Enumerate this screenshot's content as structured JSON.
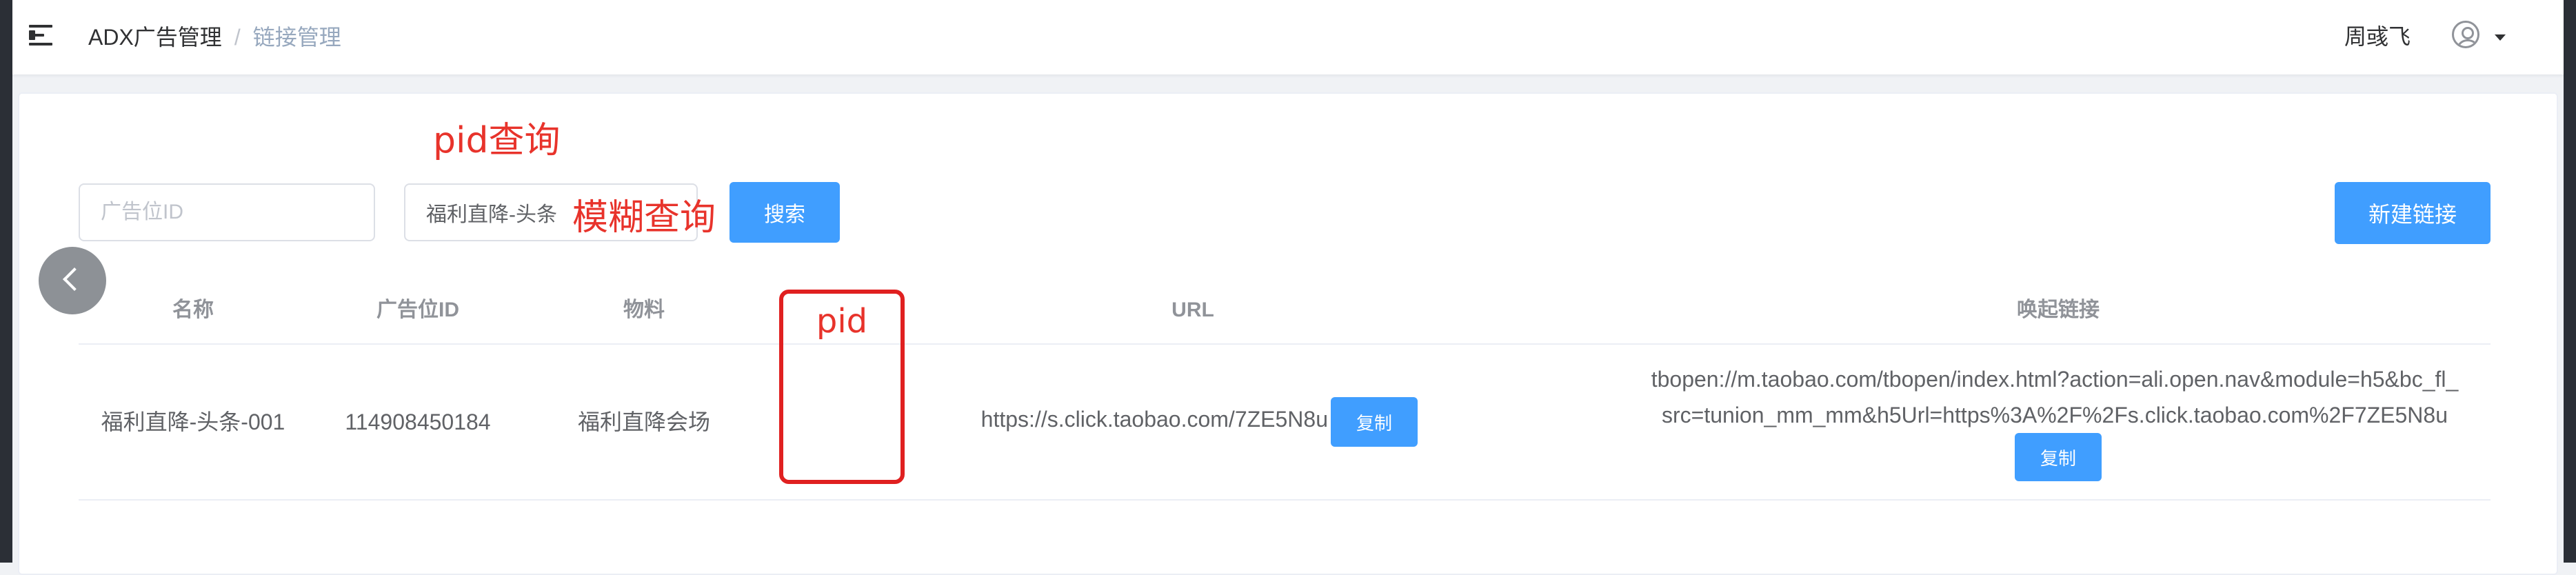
{
  "breadcrumb": {
    "root": "ADX广告管理",
    "separator": "/",
    "current": "链接管理"
  },
  "user": {
    "name": "周彧飞"
  },
  "filters": {
    "adid_placeholder": "广告位ID",
    "name_value": "福利直降-头条",
    "search_label": "搜索",
    "new_link_label": "新建链接"
  },
  "table": {
    "headers": [
      "名称",
      "广告位ID",
      "物料",
      "URL",
      "唤起链接"
    ],
    "rows": [
      {
        "name": "福利直降-头条-001",
        "adid": "114908450184",
        "material": "福利直降会场",
        "url": "https://s.click.taobao.com/7ZE5N8u",
        "url_copy_label": "复制",
        "deeplink_line1": "tbopen://m.taobao.com/tbopen/index.html?action=ali.open.nav&module=h5&bc_fl_",
        "deeplink_line2": "src=tunion_mm_mm&h5Url=https%3A%2F%2Fs.click.taobao.com%2F7ZE5N8u",
        "deeplink_copy_label": "复制"
      }
    ]
  },
  "annotations": {
    "pid_query": "pid查询",
    "fuzzy_query": "模糊查询",
    "pid_column": "pid"
  },
  "colors": {
    "primary": "#409eff",
    "annotation_red": "#e8332b",
    "header_text": "#909399",
    "body_text": "#606266"
  },
  "icons": {
    "menu": "hamburger-icon",
    "avatar": "user-circle-icon",
    "caret": "caret-down-icon",
    "back": "chevron-left-icon"
  }
}
